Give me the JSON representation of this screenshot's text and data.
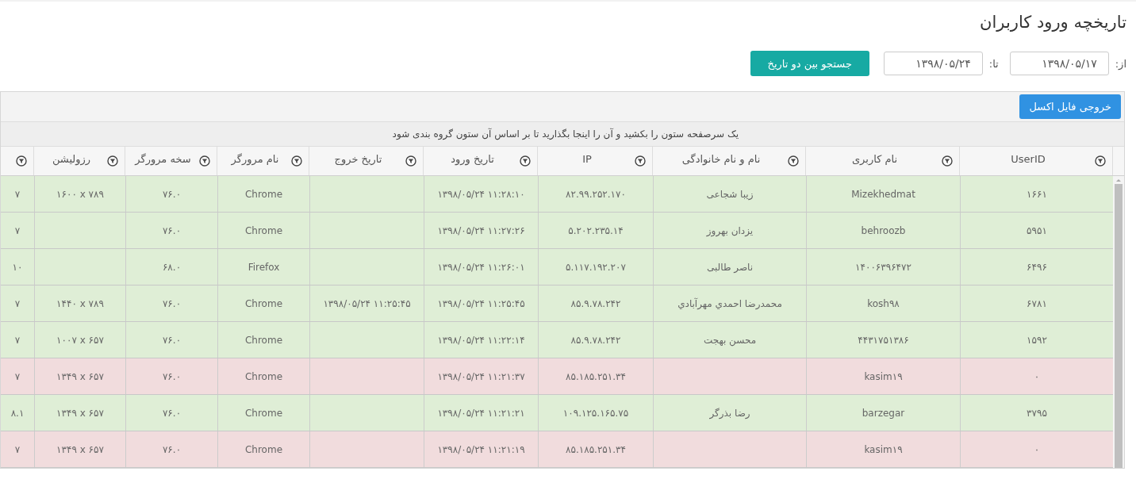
{
  "page_title": "تاریخچه ورود کاربران",
  "filter": {
    "from_label": "از:",
    "from_value": "۱۳۹۸/۰۵/۱۷",
    "to_label": "تا:",
    "to_value": "۱۳۹۸/۰۵/۲۴",
    "search_button": "جستجو بین دو تاریخ"
  },
  "grid": {
    "export_button": "خروجی فایل اکسل",
    "group_panel_hint": "یک سرصفحه ستون را بکشید و آن را اینجا بگذارید تا بر اساس آن ستون گروه بندی شود",
    "columns": [
      "UserID",
      "نام کاربری",
      "نام و نام خانوادگی",
      "IP",
      "تاریخ ورود",
      "تاریخ خروج",
      "نام مرورگر",
      "سخه مرورگر",
      "رزولیشن",
      ""
    ],
    "rows": [
      {
        "failed": false,
        "cells": [
          "۱۶۶۱",
          "Mizekhedmat",
          "زیبا شجاعی",
          "۸۲.۹۹.۲۵۲.۱۷۰",
          "۱۳۹۸/۰۵/۲۴ ۱۱:۲۸:۱۰",
          "",
          "Chrome",
          "۷۶.۰",
          "۱۶۰۰ x ۷۸۹",
          "۷"
        ]
      },
      {
        "failed": false,
        "cells": [
          "۵۹۵۱",
          "behroozb",
          "یزدان بهروز",
          "۵.۲۰۲.۲۳۵.۱۴",
          "۱۳۹۸/۰۵/۲۴ ۱۱:۲۷:۲۶",
          "",
          "Chrome",
          "۷۶.۰",
          "",
          "۷"
        ]
      },
      {
        "failed": false,
        "cells": [
          "۶۴۹۶",
          "۱۴۰۰۶۳۹۶۴۷۲",
          "ناصر طالبی",
          "۵.۱۱۷.۱۹۲.۲۰۷",
          "۱۳۹۸/۰۵/۲۴ ۱۱:۲۶:۰۱",
          "",
          "Firefox",
          "۶۸.۰",
          "",
          "۱۰"
        ]
      },
      {
        "failed": false,
        "cells": [
          "۶۷۸۱",
          "kosh۹۸",
          "محمدرضا احمدي مهرآبادي",
          "۸۵.۹.۷۸.۲۴۲",
          "۱۳۹۸/۰۵/۲۴ ۱۱:۲۵:۴۵",
          "۱۳۹۸/۰۵/۲۴ ۱۱:۲۵:۴۵",
          "Chrome",
          "۷۶.۰",
          "۱۴۴۰ x ۷۸۹",
          "۷"
        ]
      },
      {
        "failed": false,
        "cells": [
          "۱۵۹۲",
          "۴۴۳۱۷۵۱۳۸۶",
          "محسن بهجت",
          "۸۵.۹.۷۸.۲۴۲",
          "۱۳۹۸/۰۵/۲۴ ۱۱:۲۲:۱۴",
          "",
          "Chrome",
          "۷۶.۰",
          "۱۰۰۷ x ۶۵۷",
          "۷"
        ]
      },
      {
        "failed": true,
        "cells": [
          "۰",
          "kasim۱۹",
          "",
          "۸۵.۱۸۵.۲۵۱.۳۴",
          "۱۳۹۸/۰۵/۲۴ ۱۱:۲۱:۳۷",
          "",
          "Chrome",
          "۷۶.۰",
          "۱۳۴۹ x ۶۵۷",
          "۷"
        ]
      },
      {
        "failed": false,
        "cells": [
          "۳۷۹۵",
          "barzegar",
          "رضا بذرگر",
          "۱۰۹.۱۲۵.۱۶۵.۷۵",
          "۱۳۹۸/۰۵/۲۴ ۱۱:۲۱:۲۱",
          "",
          "Chrome",
          "۷۶.۰",
          "۱۳۴۹ x ۶۵۷",
          "۸.۱"
        ]
      },
      {
        "failed": true,
        "cells": [
          "۰",
          "kasim۱۹",
          "",
          "۸۵.۱۸۵.۲۵۱.۳۴",
          "۱۳۹۸/۰۵/۲۴ ۱۱:۲۱:۱۹",
          "",
          "Chrome",
          "۷۶.۰",
          "۱۳۴۹ x ۶۵۷",
          "۷"
        ]
      }
    ]
  }
}
